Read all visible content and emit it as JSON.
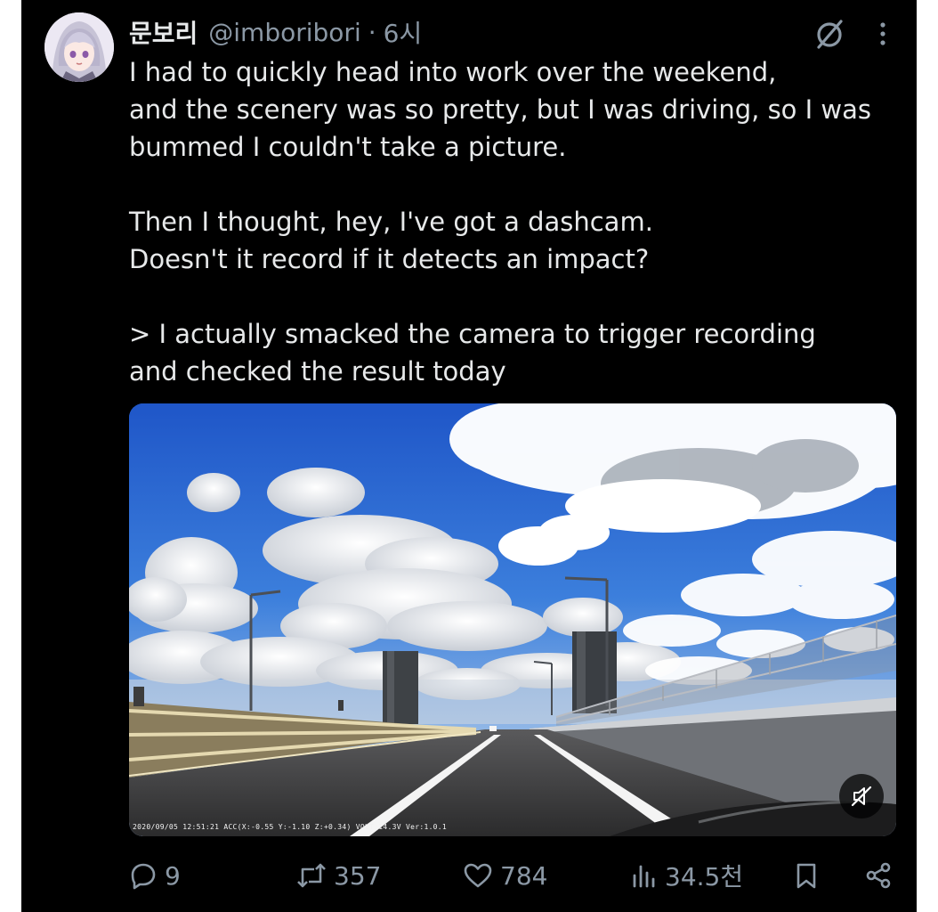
{
  "tweet": {
    "display_name": "문보리",
    "handle": "@imboribori",
    "separator": "·",
    "time": "6시",
    "text": "I had to quickly head into work over the weekend,\nand the scenery was so pretty, but I was driving, so I was\nbummed I couldn't take a picture.\n\nThen I thought, hey, I've got a dashcam.\nDoesn't it record if it detects an impact?\n\n> I actually smacked the camera to trigger recording\nand checked the result today"
  },
  "media": {
    "osd_text": "2020/09/05 12:51:21 ACC(X:-0.55 Y:-1.10 Z:+0.34) VOLT:14.3V Ver:1.0.1",
    "mute_icon": "speaker-muted-icon"
  },
  "actions": {
    "replies": "9",
    "reposts": "357",
    "likes": "784",
    "views": "34.5천"
  },
  "colors": {
    "background": "#000000",
    "text_primary": "#e7e9ea",
    "text_secondary": "#8b98a5"
  },
  "icons": [
    "grok-icon",
    "more-icon",
    "reply-icon",
    "repost-icon",
    "like-icon",
    "views-icon",
    "bookmark-icon",
    "share-icon"
  ]
}
